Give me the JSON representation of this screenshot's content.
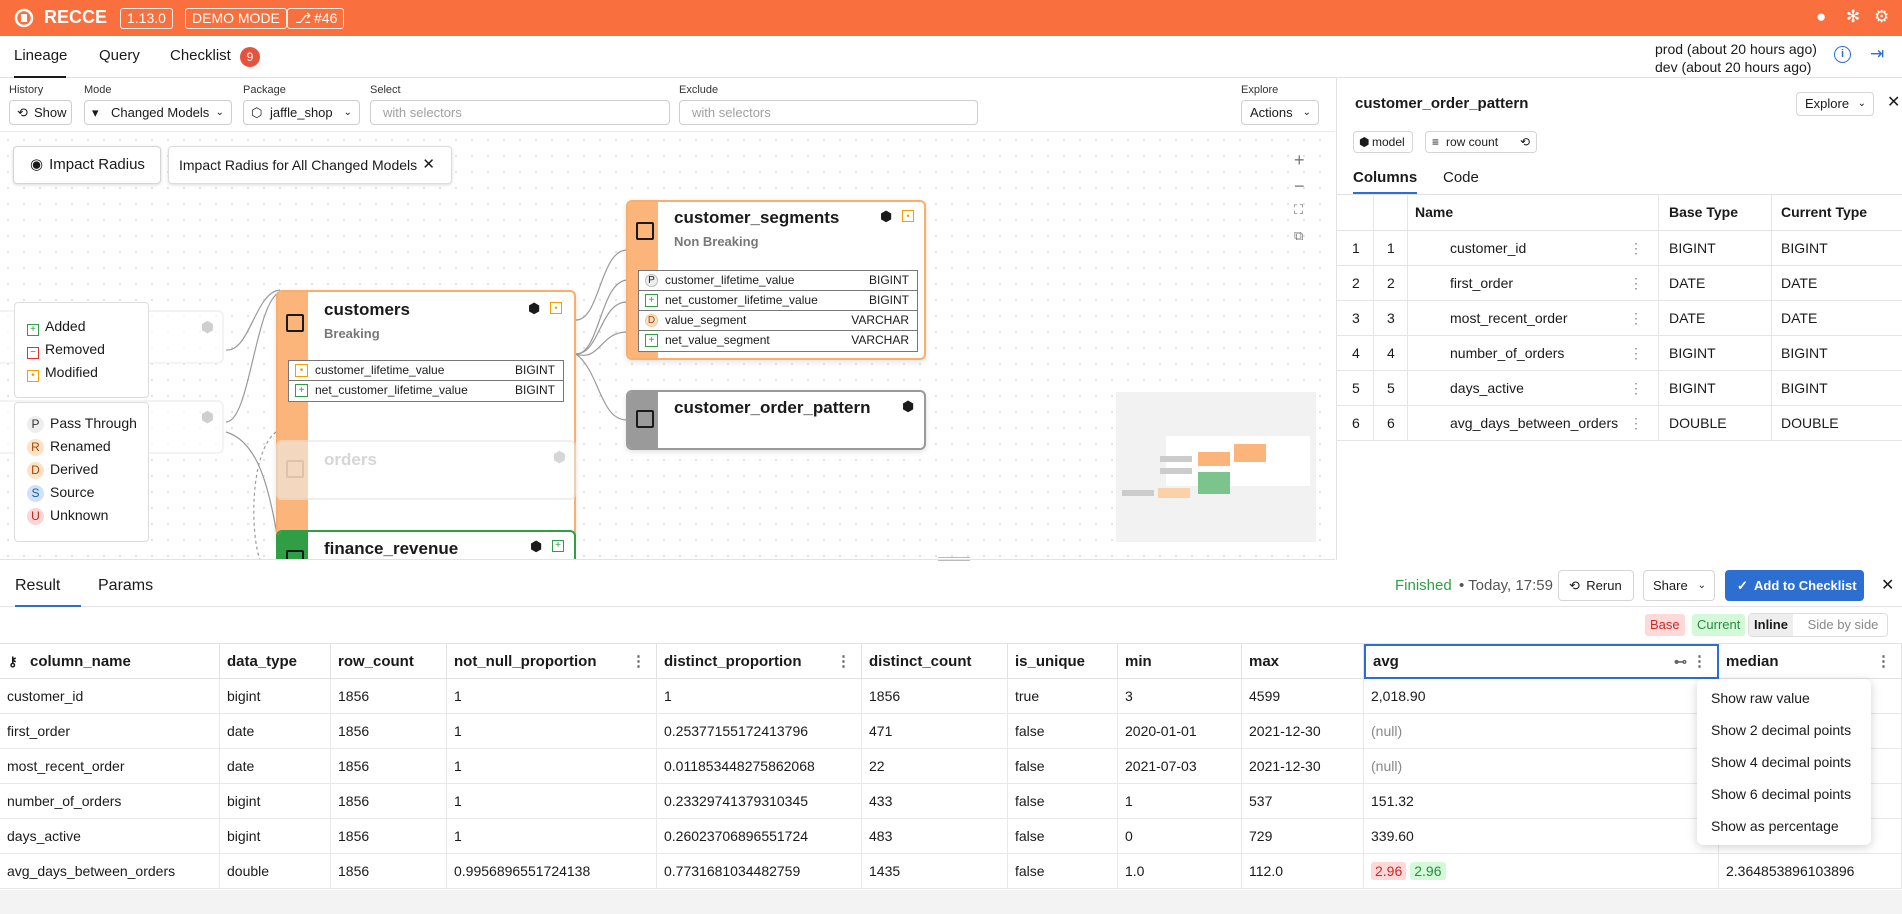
{
  "topbar": {
    "brand": "RECCE",
    "version": "1.13.0",
    "mode": "DEMO MODE",
    "pr": "#46",
    "accent": "#f9703e"
  },
  "nav": {
    "tabs": [
      {
        "label": "Lineage"
      },
      {
        "label": "Query"
      },
      {
        "label": "Checklist"
      }
    ],
    "checklist_count": "9",
    "env_prod": "prod (about 20 hours ago)",
    "env_dev": "dev (about 20 hours ago)"
  },
  "filters": {
    "history_label": "History",
    "history_btn": "Show",
    "mode_label": "Mode",
    "mode_value": "Changed Models",
    "package_label": "Package",
    "package_value": "jaffle_shop",
    "select_label": "Select",
    "select_placeholder": "with selectors",
    "exclude_label": "Exclude",
    "exclude_placeholder": "with selectors",
    "explore_label": "Explore",
    "explore_btn": "Actions"
  },
  "canvas": {
    "impact_btn": "Impact Radius",
    "impact_tag": "Impact Radius for All Changed Models",
    "legend_change": [
      "Added",
      "Removed",
      "Modified"
    ],
    "legend_col": [
      {
        "letter": "P",
        "label": "Pass Through"
      },
      {
        "letter": "R",
        "label": "Renamed"
      },
      {
        "letter": "D",
        "label": "Derived"
      },
      {
        "letter": "S",
        "label": "Source"
      },
      {
        "letter": "U",
        "label": "Unknown"
      }
    ],
    "nodes": {
      "customers": {
        "title": "customers",
        "sub": "Breaking",
        "cols": [
          {
            "name": "customer_lifetime_value",
            "type": "BIGINT"
          },
          {
            "name": "net_customer_lifetime_value",
            "type": "BIGINT"
          }
        ]
      },
      "segments": {
        "title": "customer_segments",
        "sub": "Non Breaking",
        "cols": [
          {
            "badge": "P",
            "name": "customer_lifetime_value",
            "type": "BIGINT"
          },
          {
            "badge": "+",
            "name": "net_customer_lifetime_value",
            "type": "BIGINT"
          },
          {
            "badge": "D",
            "name": "value_segment",
            "type": "VARCHAR"
          },
          {
            "badge": "+",
            "name": "net_value_segment",
            "type": "VARCHAR"
          }
        ]
      },
      "order_pattern": {
        "title": "customer_order_pattern"
      },
      "orders": {
        "title": "orders"
      },
      "finance": {
        "title": "finance_revenue"
      }
    }
  },
  "panel": {
    "title": "customer_order_pattern",
    "explore": "Explore",
    "tag_model": "model",
    "tag_rowcount": "row count",
    "tabs": [
      "Columns",
      "Code"
    ],
    "headers": [
      "Name",
      "Base Type",
      "Current Type"
    ],
    "rows": [
      {
        "i": "1",
        "j": "1",
        "name": "customer_id",
        "base": "BIGINT",
        "cur": "BIGINT"
      },
      {
        "i": "2",
        "j": "2",
        "name": "first_order",
        "base": "DATE",
        "cur": "DATE"
      },
      {
        "i": "3",
        "j": "3",
        "name": "most_recent_order",
        "base": "DATE",
        "cur": "DATE"
      },
      {
        "i": "4",
        "j": "4",
        "name": "number_of_orders",
        "base": "BIGINT",
        "cur": "BIGINT"
      },
      {
        "i": "5",
        "j": "5",
        "name": "days_active",
        "base": "BIGINT",
        "cur": "BIGINT"
      },
      {
        "i": "6",
        "j": "6",
        "name": "avg_days_between_orders",
        "base": "DOUBLE",
        "cur": "DOUBLE"
      }
    ]
  },
  "result": {
    "tabs": [
      "Result",
      "Params"
    ],
    "status": "Finished",
    "time": "• Today, 17:59",
    "rerun": "Rerun",
    "share": "Share",
    "add": "Add to Checklist",
    "base": "Base",
    "current": "Current",
    "inline": "Inline",
    "side": "Side by side",
    "headers": [
      "column_name",
      "data_type",
      "row_count",
      "not_null_proportion",
      "distinct_proportion",
      "distinct_count",
      "is_unique",
      "min",
      "max",
      "avg",
      "median"
    ],
    "rows": [
      [
        "customer_id",
        "bigint",
        "1856",
        "1",
        "1",
        "1856",
        "true",
        "3",
        "4599",
        "2,018.90",
        ""
      ],
      [
        "first_order",
        "date",
        "1856",
        "1",
        "0.25377155172413796",
        "471",
        "false",
        "2020-01-01",
        "2021-12-30",
        "(null)",
        ""
      ],
      [
        "most_recent_order",
        "date",
        "1856",
        "1",
        "0.011853448275862068",
        "22",
        "false",
        "2021-07-03",
        "2021-12-30",
        "(null)",
        ""
      ],
      [
        "number_of_orders",
        "bigint",
        "1856",
        "1",
        "0.23329741379310345",
        "433",
        "false",
        "1",
        "537",
        "151.32",
        ""
      ],
      [
        "days_active",
        "bigint",
        "1856",
        "1",
        "0.26023706896551724",
        "483",
        "false",
        "0",
        "729",
        "339.60",
        ""
      ],
      [
        "avg_days_between_orders",
        "double",
        "1856",
        "0.9956896551724138",
        "0.7731681034482759",
        "1435",
        "false",
        "1.0",
        "112.0",
        "",
        "2.364853896103896"
      ]
    ],
    "avg_base": "2.96",
    "avg_current": "2.96",
    "menu": [
      "Show raw value",
      "Show 2 decimal points",
      "Show 4 decimal points",
      "Show 6 decimal points",
      "Show as percentage"
    ]
  }
}
